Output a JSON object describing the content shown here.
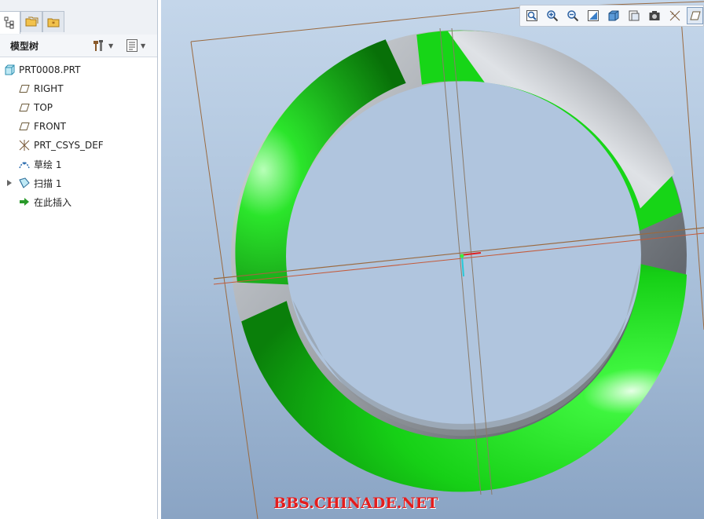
{
  "tree_panel": {
    "tabs": [
      {
        "name": "model-tree-tab",
        "icon": "model-tree-icon",
        "active": true
      },
      {
        "name": "folder-browser-tab",
        "icon": "folder-icon",
        "active": false
      },
      {
        "name": "favorites-tab",
        "icon": "favorites-icon",
        "active": false
      }
    ],
    "title": "模型树",
    "settings_icon": "tools-icon",
    "show_icon": "list-icon",
    "items": [
      {
        "label": "PRT0008.PRT",
        "icon": "part-icon",
        "indent": 0,
        "expandable": false
      },
      {
        "label": "RIGHT",
        "icon": "datum-plane-icon",
        "indent": 1,
        "expandable": false
      },
      {
        "label": "TOP",
        "icon": "datum-plane-icon",
        "indent": 1,
        "expandable": false
      },
      {
        "label": "FRONT",
        "icon": "datum-plane-icon",
        "indent": 1,
        "expandable": false
      },
      {
        "label": "PRT_CSYS_DEF",
        "icon": "csys-icon",
        "indent": 1,
        "expandable": false
      },
      {
        "label": "草绘 1",
        "icon": "sketch-icon",
        "indent": 1,
        "expandable": false
      },
      {
        "label": "扫描 1",
        "icon": "sweep-icon",
        "indent": 1,
        "expandable": true
      },
      {
        "label": "在此插入",
        "icon": "insert-here-icon",
        "indent": 1,
        "expandable": false
      }
    ]
  },
  "view_toolbar": {
    "buttons": [
      {
        "name": "refit-button",
        "icon": "refit-icon"
      },
      {
        "name": "zoom-in-button",
        "icon": "zoom-in-icon"
      },
      {
        "name": "zoom-out-button",
        "icon": "zoom-out-icon"
      },
      {
        "name": "repaint-button",
        "icon": "repaint-icon"
      },
      {
        "name": "display-style-button",
        "icon": "display-style-icon"
      },
      {
        "name": "saved-views-button",
        "icon": "saved-views-icon"
      },
      {
        "name": "view-manager-button",
        "icon": "view-manager-icon"
      },
      {
        "name": "datum-display-button",
        "icon": "datum-display-icon"
      },
      {
        "name": "plane-display-button",
        "icon": "plane-display-icon"
      }
    ]
  },
  "colors": {
    "ring_green": "#1ee01e",
    "ring_gray": "#a0a4aa",
    "datum_line": "#9a6a40",
    "viewport_top": "#c4d6ea",
    "viewport_bottom": "#8aa4c4"
  },
  "watermark": "BBS.CHINADE.NET"
}
